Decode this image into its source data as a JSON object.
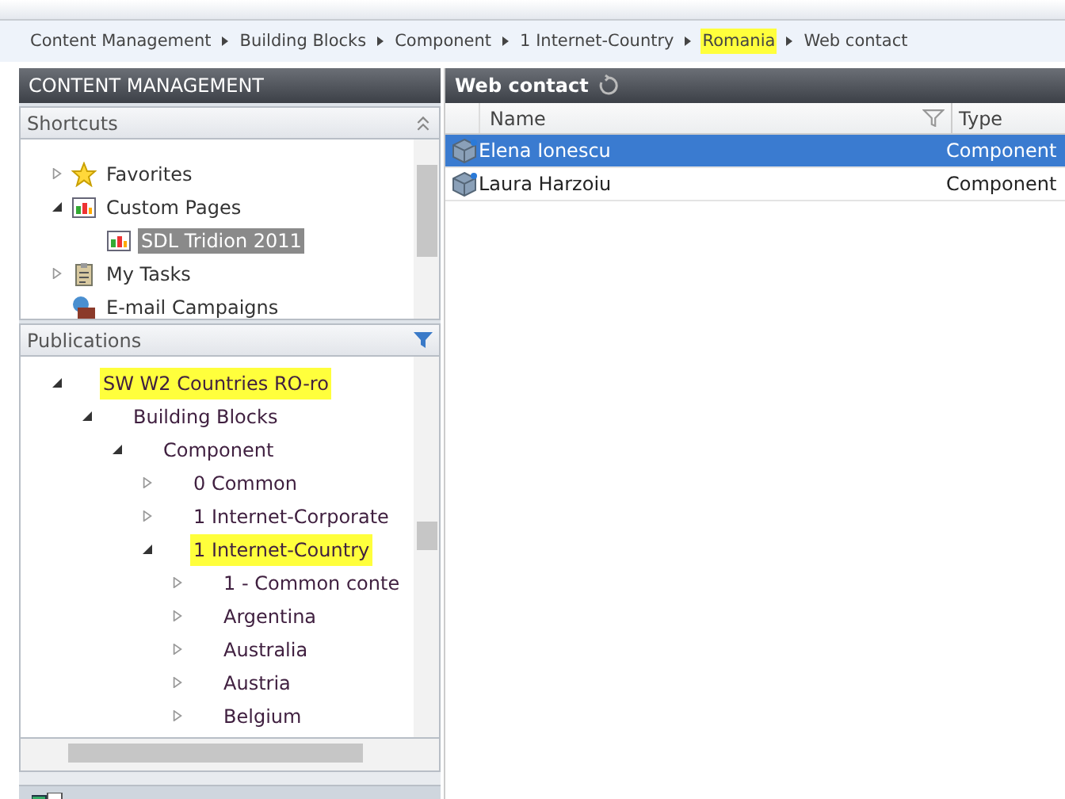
{
  "breadcrumb": [
    {
      "label": "Content Management",
      "highlighted": false
    },
    {
      "label": "Building Blocks",
      "highlighted": false
    },
    {
      "label": "Component",
      "highlighted": false
    },
    {
      "label": "1 Internet-Country",
      "highlighted": false
    },
    {
      "label": "Romania",
      "highlighted": true
    },
    {
      "label": "Web contact",
      "highlighted": false
    }
  ],
  "left_panel": {
    "title": "CONTENT MANAGEMENT",
    "shortcuts": {
      "title": "Shortcuts",
      "items": [
        {
          "label": "Favorites",
          "kind": "star",
          "expanded": false,
          "selected": false
        },
        {
          "label": "Custom Pages",
          "kind": "page",
          "expanded": true,
          "selected": false,
          "children": [
            {
              "label": "SDL Tridion 2011",
              "kind": "page",
              "selected": true
            }
          ]
        },
        {
          "label": "My Tasks",
          "kind": "tasks",
          "expanded": false,
          "selected": false
        },
        {
          "label": "E-mail Campaigns",
          "kind": "campaign",
          "selected": false
        }
      ]
    },
    "publications": {
      "title": "Publications",
      "items": [
        {
          "label": "SW W2 Countries RO-ro",
          "expanded": true,
          "highlighted": true,
          "children": [
            {
              "label": "Building Blocks",
              "expanded": true,
              "highlighted": false,
              "children": [
                {
                  "label": "Component",
                  "expanded": true,
                  "highlighted": false,
                  "children": [
                    {
                      "label": "0 Common",
                      "expanded": false,
                      "highlighted": false
                    },
                    {
                      "label": "1 Internet-Corporate",
                      "expanded": false,
                      "highlighted": false
                    },
                    {
                      "label": "1 Internet-Country",
                      "expanded": true,
                      "highlighted": true,
                      "children": [
                        {
                          "label": "1 - Common conte",
                          "expanded": false,
                          "highlighted": false
                        },
                        {
                          "label": "Argentina",
                          "expanded": false,
                          "highlighted": false
                        },
                        {
                          "label": "Australia",
                          "expanded": false,
                          "highlighted": false
                        },
                        {
                          "label": "Austria",
                          "expanded": false,
                          "highlighted": false
                        },
                        {
                          "label": "Belgium",
                          "expanded": false,
                          "highlighted": false
                        }
                      ]
                    }
                  ]
                }
              ]
            }
          ]
        }
      ]
    }
  },
  "list": {
    "title": "Web contact",
    "columns": [
      "Name",
      "Type"
    ],
    "rows": [
      {
        "name": "Elena Ionescu",
        "type": "Component",
        "selected": true
      },
      {
        "name": "Laura Harzoiu",
        "type": "Component",
        "selected": false
      }
    ]
  }
}
